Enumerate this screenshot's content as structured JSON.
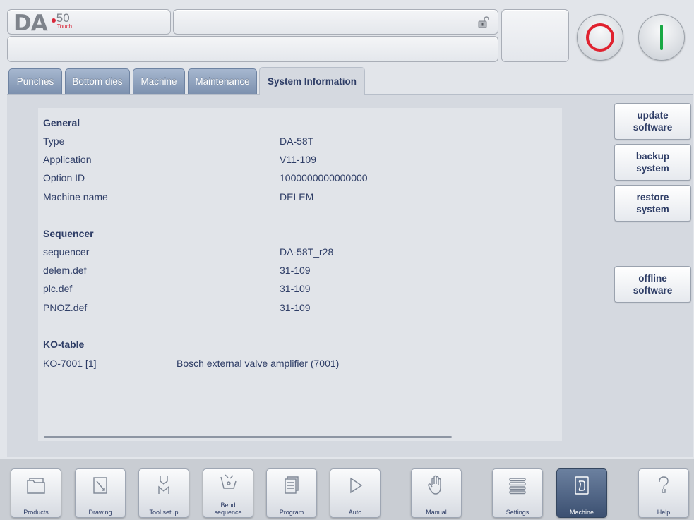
{
  "header": {
    "logo_main": "DA",
    "logo_number": "50",
    "logo_sub": "Touch"
  },
  "tabs": [
    {
      "label": "Punches",
      "active": false
    },
    {
      "label": "Bottom dies",
      "active": false
    },
    {
      "label": "Machine",
      "active": false
    },
    {
      "label": "Maintenance",
      "active": false
    },
    {
      "label": "System Information",
      "active": true
    }
  ],
  "system_info": {
    "general": {
      "heading": "General",
      "rows": [
        {
          "label": "Type",
          "value": "DA-58T"
        },
        {
          "label": "Application",
          "value": "V11-109"
        },
        {
          "label": "Option ID",
          "value": "1000000000000000"
        },
        {
          "label": "Machine name",
          "value": "DELEM"
        }
      ]
    },
    "sequencer": {
      "heading": "Sequencer",
      "rows": [
        {
          "label": "sequencer",
          "value": "DA-58T_r28"
        },
        {
          "label": "delem.def",
          "value": "31-109"
        },
        {
          "label": "plc.def",
          "value": "31-109"
        },
        {
          "label": "PNOZ.def",
          "value": "31-109"
        }
      ]
    },
    "ko_table": {
      "heading": "KO-table",
      "rows": [
        {
          "label": "KO-7001 [1]",
          "value": "Bosch external valve amplifier (7001)"
        }
      ]
    }
  },
  "side_buttons": [
    {
      "line1": "update",
      "line2": "software"
    },
    {
      "line1": "backup",
      "line2": "system"
    },
    {
      "line1": "restore",
      "line2": "system"
    },
    {
      "line1": "offline",
      "line2": "software"
    }
  ],
  "bottom_nav": [
    {
      "label": "Products",
      "icon": "folder-icon"
    },
    {
      "label": "Drawing",
      "icon": "drawing-icon"
    },
    {
      "label": "Tool setup",
      "icon": "tool-setup-icon"
    },
    {
      "label": "Bend",
      "label2": "sequence",
      "icon": "bend-sequence-icon"
    },
    {
      "label": "Program",
      "icon": "program-icon"
    },
    {
      "label": "Auto",
      "icon": "play-icon"
    },
    {
      "label": "Manual",
      "icon": "hand-icon"
    },
    {
      "label": "Settings",
      "icon": "settings-list-icon"
    },
    {
      "label": "Machine",
      "icon": "machine-icon",
      "active": true
    },
    {
      "label": "Help",
      "icon": "help-icon"
    }
  ],
  "colors": {
    "accent": "#2e3d66",
    "stop": "#e0222f",
    "start": "#19a844",
    "tab_inactive": "#8a9dba",
    "nav_active": "#4d6283"
  }
}
